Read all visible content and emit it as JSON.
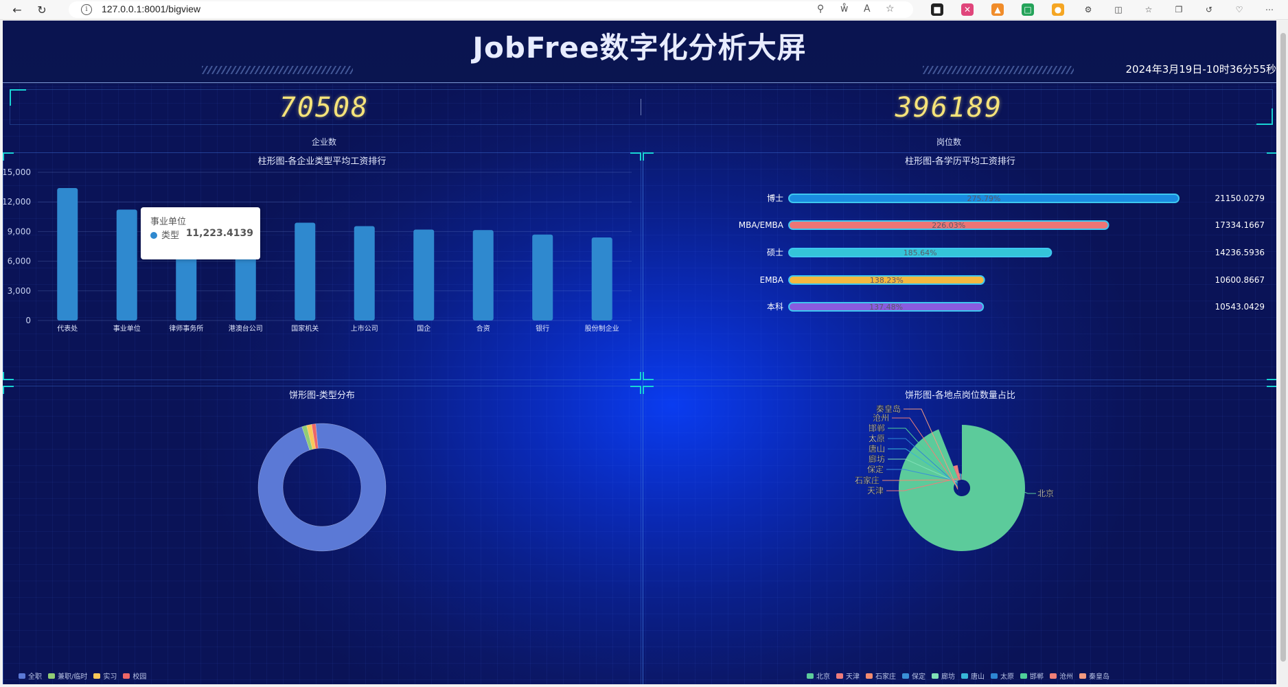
{
  "browser": {
    "url": "127.0.0.1:8001/bigview"
  },
  "page": {
    "title": "JobFree数字化分析大屏",
    "datetime": "2024年3月19日-10时36分55秒"
  },
  "stats": [
    {
      "value": "70508",
      "label": "企业数"
    },
    {
      "value": "396189",
      "label": "岗位数"
    }
  ],
  "colors": {
    "bar_blue": "#2f89cf",
    "stat_yellow": "#f5e37a",
    "accent_cyan": "#19d4d4"
  },
  "chart_data": [
    {
      "type": "bar",
      "title": "柱形图-各企业类型平均工资排行",
      "categories": [
        "代表处",
        "事业单位",
        "律师事务所",
        "港澳台公司",
        "国家机关",
        "上市公司",
        "国企",
        "合资",
        "银行",
        "股份制企业"
      ],
      "series": [
        {
          "name": "类型",
          "values": [
            13400,
            11223.4139,
            10300,
            10100,
            9900,
            9550,
            9200,
            9150,
            8700,
            8400
          ]
        }
      ],
      "ylim": [
        0,
        15000
      ],
      "yticks": [
        "0",
        "3,000",
        "6,000",
        "9,000",
        "12,000",
        "15,000"
      ],
      "color": "#2f89cf",
      "tooltip": {
        "category": "事业单位",
        "series": "类型",
        "value": "11,223.4139"
      }
    },
    {
      "type": "bar",
      "orientation": "horizontal",
      "title": "柱形图-各学历平均工资排行",
      "categories": [
        "博士",
        "MBA/EMBA",
        "硕士",
        "EMBA",
        "本科"
      ],
      "values": [
        21150.0279,
        17334.1667,
        14236.5936,
        10600.8667,
        10543.0429
      ],
      "value_labels": [
        "21150.0279",
        "17334.1667",
        "14236.5936",
        "10600.8667",
        "10543.0429"
      ],
      "percent_labels": [
        "275.79%",
        "226.03%",
        "185.64%",
        "138.23%",
        "137.48%"
      ],
      "colors": [
        "#1a8ce0",
        "#ec7575",
        "#34c5d8",
        "#f4b83f",
        "#8a5bdf"
      ]
    },
    {
      "type": "pie",
      "style": "donut",
      "title": "饼形图-类型分布",
      "labels": [
        "全职",
        "兼职/临时",
        "实习",
        "校园"
      ],
      "values": [
        96.5,
        1.2,
        1.3,
        1.0
      ],
      "colors": [
        "#5b79d6",
        "#91cc75",
        "#fac858",
        "#ee6666"
      ],
      "legend": "bottom-left"
    },
    {
      "type": "pie",
      "style": "rose",
      "title": "饼形图-各地点岗位数量占比",
      "labels": [
        "北京",
        "天津",
        "石家庄",
        "保定",
        "廊坊",
        "唐山",
        "太原",
        "邯郸",
        "沧州",
        "秦皇岛"
      ],
      "values": [
        94.0,
        3.0,
        0.5,
        0.4,
        0.4,
        0.4,
        0.4,
        0.3,
        0.3,
        0.3
      ],
      "colors": [
        "#5ccb9b",
        "#ee7c7c",
        "#f38b70",
        "#3a90d8",
        "#7fe0b6",
        "#37b6d8",
        "#2e86d3",
        "#4fcf9a",
        "#f07f78",
        "#f39a80"
      ],
      "legend": "bottom-center"
    }
  ]
}
